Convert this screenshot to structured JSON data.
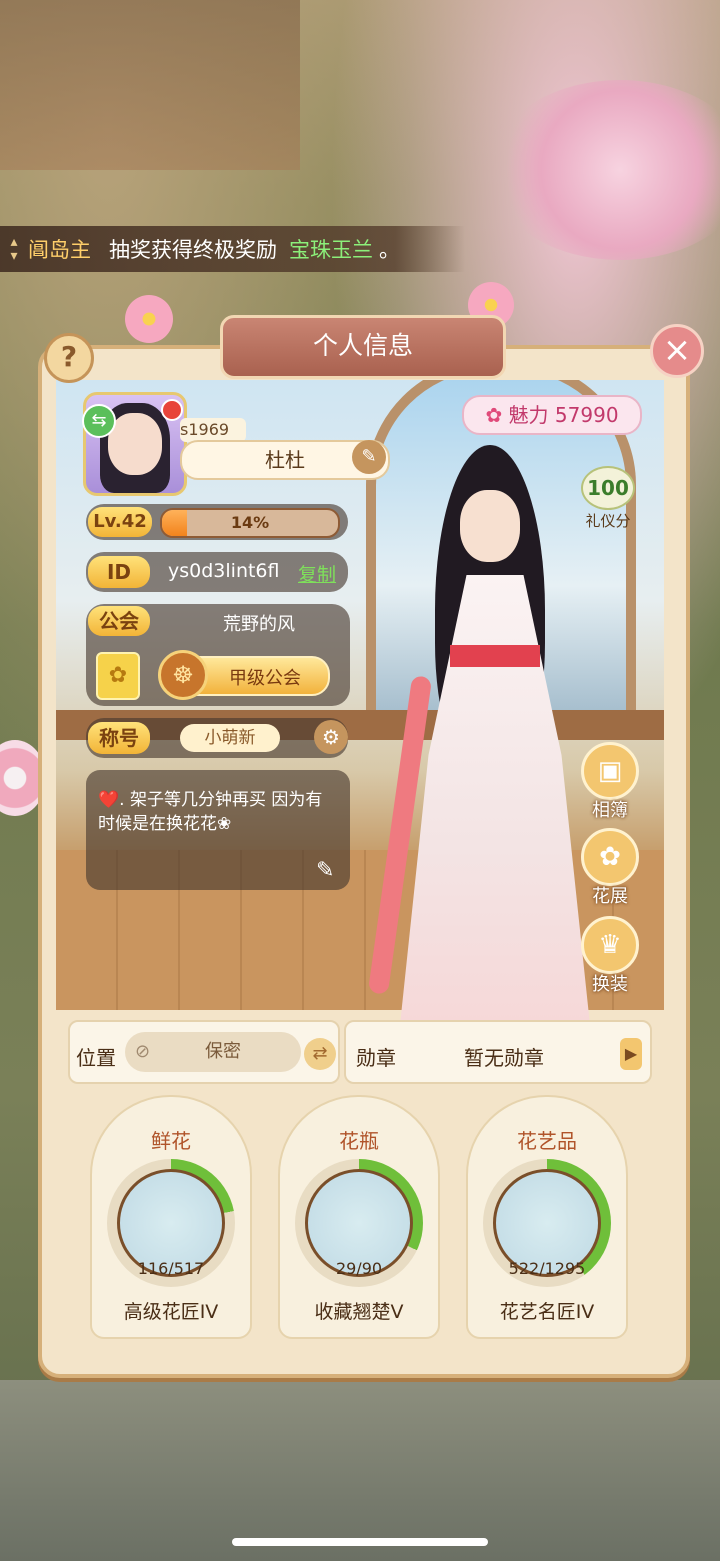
{
  "marquee": {
    "who": "阊岛主",
    "text": "抽奖获得终极奖励",
    "item": "宝珠玉兰",
    "end": "。"
  },
  "panel": {
    "title": "个人信息",
    "help": "?",
    "close": "×"
  },
  "profile": {
    "server": "s1969",
    "name": "杜杜",
    "level": "Lv.42",
    "xp_text": "14%",
    "xp_progress": 0.14,
    "id_label": "ID",
    "id_value": "ys0d3lint6fl",
    "copy": "复制",
    "guild_label": "公会",
    "guild_name": "荒野的风",
    "guild_rank": "甲级公会",
    "title_label": "称号",
    "title_value": "小萌新",
    "bio": "❤️. 架子等几分钟再买  因为有时候是在换花花❀"
  },
  "stats": {
    "charm": "魅力 57990",
    "etiquette_value": "100",
    "etiquette_label": "礼仪分"
  },
  "side_buttons": [
    "相簿",
    "花展",
    "换装"
  ],
  "info": {
    "location_label": "位置",
    "location_value": "保密",
    "medal_label": "勋章",
    "medal_value": "暂无勋章"
  },
  "cards": [
    {
      "title": "鲜花",
      "count": "116/517",
      "rank": "高级花匠IV",
      "progress": 0.22
    },
    {
      "title": "花瓶",
      "count": "29/90",
      "rank": "收藏翘楚V",
      "progress": 0.32
    },
    {
      "title": "花艺品",
      "count": "522/1295",
      "rank": "花艺名匠IV",
      "progress": 0.4
    }
  ],
  "colors": {
    "accent": "#f2831c",
    "ring": "#6fbf3a",
    "copy": "#7fe05b"
  }
}
